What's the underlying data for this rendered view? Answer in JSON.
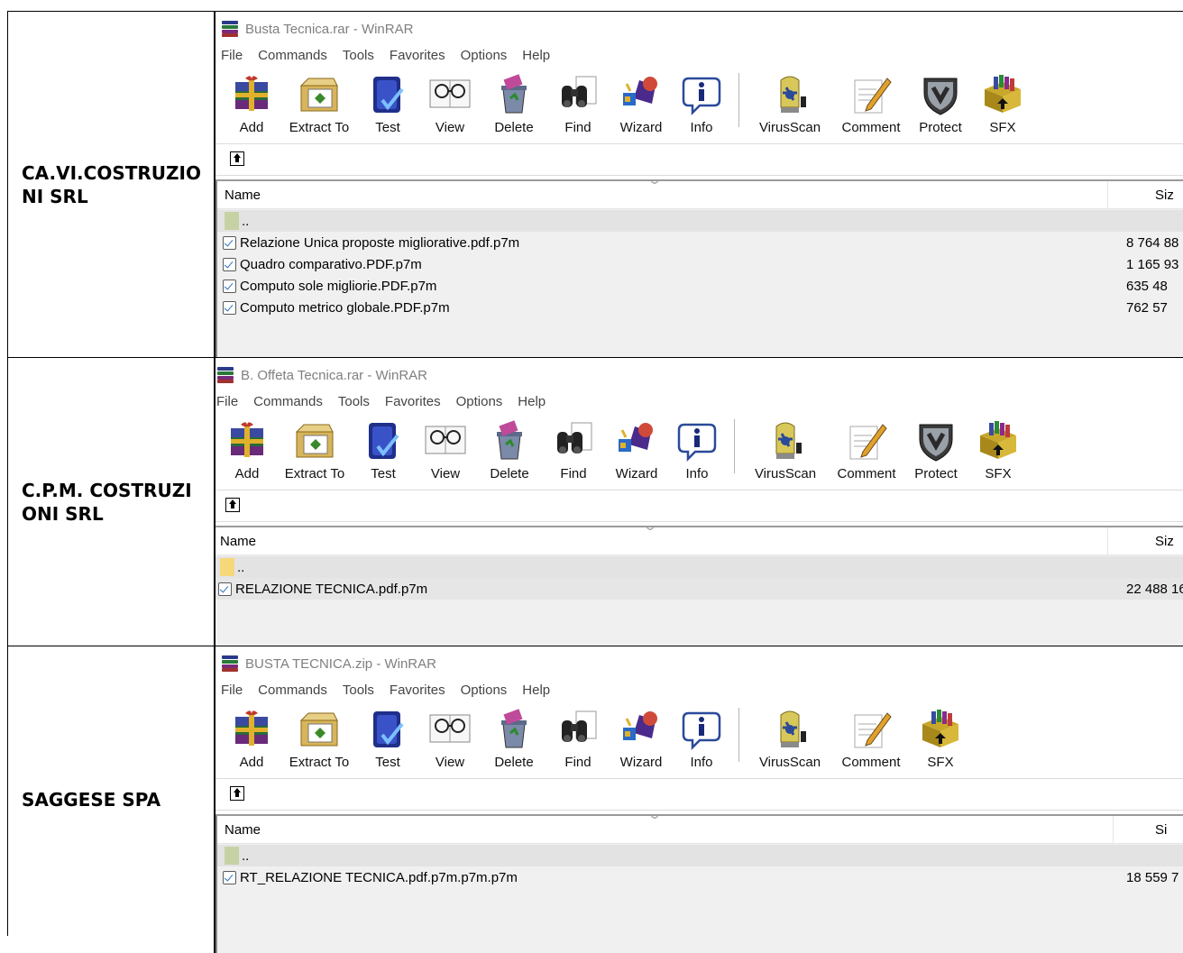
{
  "rows": [
    {
      "company": "CA.VI.COSTRUZIONI SRL",
      "window": {
        "title": "Busta Tecnica.rar - WinRAR",
        "menu": [
          "File",
          "Commands",
          "Tools",
          "Favorites",
          "Options",
          "Help"
        ],
        "toolbar": [
          "Add",
          "Extract To",
          "Test",
          "View",
          "Delete",
          "Find",
          "Wizard",
          "Info",
          "VirusScan",
          "Comment",
          "Protect",
          "SFX"
        ],
        "columns": {
          "name": "Name",
          "size": "Siz"
        },
        "parent": "..",
        "files": [
          {
            "name": "Relazione Unica proposte migliorative.pdf.p7m",
            "size": "8 764 88"
          },
          {
            "name": "Quadro comparativo.PDF.p7m",
            "size": "1 165 93"
          },
          {
            "name": "Computo sole migliorie.PDF.p7m",
            "size": "635 48"
          },
          {
            "name": "Computo metrico globale.PDF.p7m",
            "size": "762 57"
          }
        ]
      }
    },
    {
      "company": "C.P.M. COSTRUZIONI SRL",
      "window": {
        "title": "B. Offeta Tecnica.rar - WinRAR",
        "menu": [
          "File",
          "Commands",
          "Tools",
          "Favorites",
          "Options",
          "Help"
        ],
        "toolbar": [
          "Add",
          "Extract To",
          "Test",
          "View",
          "Delete",
          "Find",
          "Wizard",
          "Info",
          "VirusScan",
          "Comment",
          "Protect",
          "SFX"
        ],
        "columns": {
          "name": "Name",
          "size": "Siz"
        },
        "parent": "..",
        "files": [
          {
            "name": "RELAZIONE TECNICA.pdf.p7m",
            "size": "22 488 16"
          }
        ]
      }
    },
    {
      "company": "SAGGESE SPA",
      "window": {
        "title": "BUSTA TECNICA.zip - WinRAR",
        "menu": [
          "File",
          "Commands",
          "Tools",
          "Favorites",
          "Options",
          "Help"
        ],
        "toolbar": [
          "Add",
          "Extract To",
          "Test",
          "View",
          "Delete",
          "Find",
          "Wizard",
          "Info",
          "VirusScan",
          "Comment",
          "SFX"
        ],
        "columns": {
          "name": "Name",
          "size": "Si"
        },
        "parent": "..",
        "files": [
          {
            "name": "RT_RELAZIONE TECNICA.pdf.p7m.p7m.p7m",
            "size": "18 559 7"
          }
        ]
      }
    }
  ]
}
